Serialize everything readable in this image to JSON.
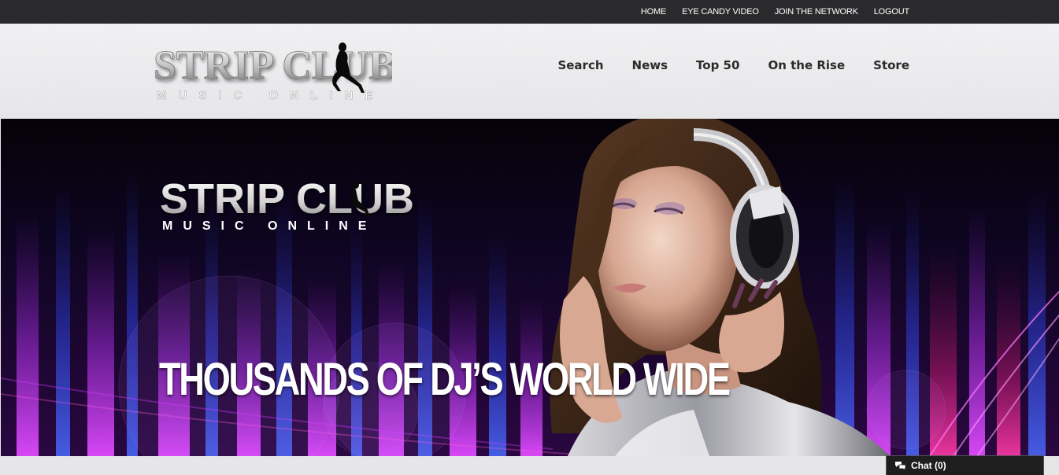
{
  "topnav": {
    "items": [
      {
        "label": "HOME"
      },
      {
        "label": "EYE CANDY VIDEO"
      },
      {
        "label": "JOIN THE NETWORK"
      },
      {
        "label": "LOGOUT"
      }
    ]
  },
  "logo": {
    "line1": "STRIP CLUB",
    "line2": "MUSIC ONLINE"
  },
  "mainnav": {
    "items": [
      {
        "label": "Search"
      },
      {
        "label": "News"
      },
      {
        "label": "Top 50"
      },
      {
        "label": "On the Rise"
      },
      {
        "label": "Store"
      }
    ]
  },
  "hero": {
    "brand_line1": "STRIP CLUB",
    "brand_line2": "MUSIC ONLINE",
    "headline": "THOUSANDS OF DJ’S WORLD WIDE"
  },
  "chat": {
    "label": "Chat (0)",
    "icon": "speech-bubbles-icon"
  },
  "colors": {
    "topbar": "#2a2a2c",
    "header_bg": "#e8e8ea",
    "hero_purple": "#b02adf",
    "hero_blue": "#2a3dd8",
    "chat_bg": "#1e1e1e"
  }
}
